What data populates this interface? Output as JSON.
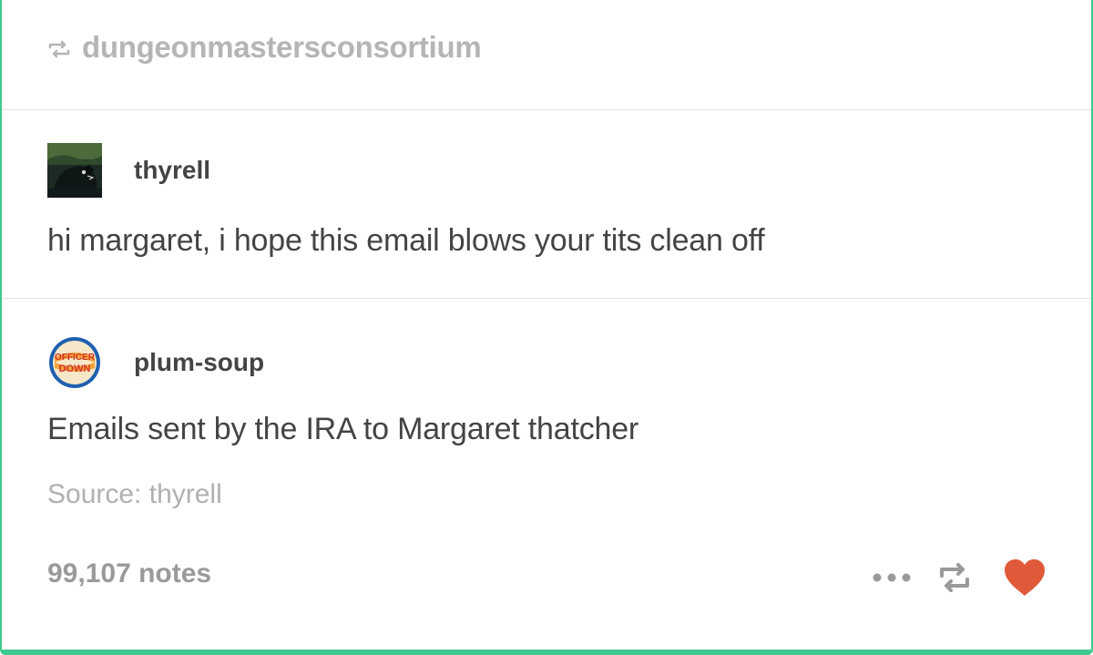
{
  "reblog_header": {
    "blog_name": "dungeonmastersconsortium",
    "icon": "reblog-icon"
  },
  "posts": [
    {
      "username": "thyrell",
      "avatar": "thyrell-avatar",
      "text": "hi margaret, i hope this email blows your tits clean off"
    },
    {
      "username": "plum-soup",
      "avatar": "officer-down-badge-avatar",
      "avatar_text_line1": "OFFICER",
      "avatar_text_line2": "DOWN",
      "text": "Emails sent by the IRA to Margaret thatcher"
    }
  ],
  "source": {
    "label": "Source:",
    "name": "thyrell"
  },
  "footer": {
    "notes": "99,107 notes",
    "actions": [
      "more-icon",
      "reblog-icon",
      "heart-icon"
    ]
  },
  "colors": {
    "accent": "#3fc98f",
    "heart": "#e05a3a",
    "muted": "#b5b5b5",
    "text": "#444444"
  }
}
